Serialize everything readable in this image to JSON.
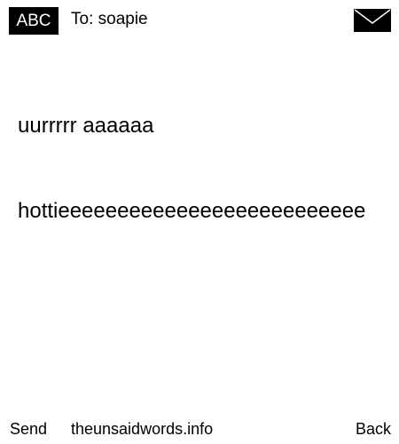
{
  "header": {
    "mode_label": "ABC",
    "recipient": "To: soapie",
    "icon": "envelope-icon"
  },
  "message": {
    "line1": "uurrrrr aaaaaa",
    "line2": "hottieeeeeeeeeeeeeeeeeeeeeeeeee"
  },
  "footer": {
    "send_label": "Send",
    "site": "theunsaidwords.info",
    "back_label": "Back"
  }
}
